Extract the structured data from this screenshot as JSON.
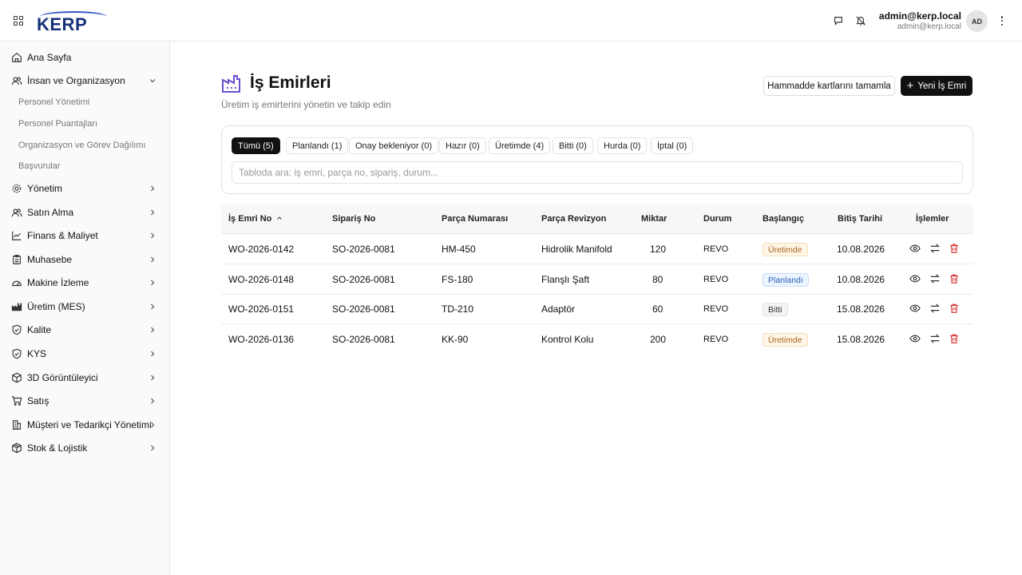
{
  "header": {
    "user_name": "admin@kerp.local",
    "user_email": "admin@kerp.local",
    "avatar_initials": "AD"
  },
  "sidebar": {
    "items": [
      {
        "label": "Ana Sayfa",
        "icon": "home-icon"
      },
      {
        "label": "İnsan ve Organizasyon",
        "icon": "users-icon",
        "expanded": true,
        "children": [
          "Personel Yönetimi",
          "Personel Puantajları",
          "Organizasyon ve Görev Dağılımı",
          "Başvurular"
        ]
      },
      {
        "label": "Yönetim",
        "icon": "gear-icon"
      },
      {
        "label": "Satın Alma",
        "icon": "users-icon"
      },
      {
        "label": "Finans & Maliyet",
        "icon": "chart-line-icon"
      },
      {
        "label": "Muhasebe",
        "icon": "clipboard-icon"
      },
      {
        "label": "Makine İzleme",
        "icon": "gauge-icon"
      },
      {
        "label": "Üretim (MES)",
        "icon": "factory-icon"
      },
      {
        "label": "Kalite",
        "icon": "shield-check-icon"
      },
      {
        "label": "KYS",
        "icon": "shield-check-icon"
      },
      {
        "label": "3D Görüntüleyici",
        "icon": "cube-icon"
      },
      {
        "label": "Satış",
        "icon": "cart-icon"
      },
      {
        "label": "Müşteri ve Tedarikçi Yönetimi",
        "icon": "building-icon"
      },
      {
        "label": "Stok & Lojistik",
        "icon": "package-icon"
      }
    ]
  },
  "page": {
    "title": "İş Emirleri",
    "subtitle": "Üretim iş emirterini yönetin ve takip edin",
    "btn_secondary": "Hammadde kartlarını tamamla",
    "btn_primary": "Yeni İş Emri"
  },
  "filters": {
    "tabs": [
      "Tümü (5)",
      "Planlandı (1)",
      "Onay bekleniyor (0)",
      "Hazır (0)",
      "Üretimde (4)",
      "Bitti (0)",
      "Hurda (0)",
      "İptal (0)"
    ],
    "active_tab": "Tümü (5)",
    "search_placeholder": "Tabloda ara: iş emri, parça no, sipariş, durum..."
  },
  "table": {
    "columns": [
      "İş Emri No",
      "Sipariş No",
      "Parça Numarası",
      "Parça Revizyon",
      "Miktar",
      "Durum",
      "Başlangıç",
      "Bitiş Tarihi",
      "İşlemler"
    ],
    "sorted_column": "İş Emri No",
    "sort_direction": "asc",
    "rows": [
      {
        "wo": "WO-2026-0142",
        "so": "SO-2026-0081",
        "part": "HM-450",
        "rev": "Hidrolik Manifold",
        "qty": "120",
        "status": "REVO",
        "start": "Üretimde",
        "start_type": "uretimde",
        "end": "10.08.2026"
      },
      {
        "wo": "WO-2026-0148",
        "so": "SO-2026-0081",
        "part": "FS-180",
        "rev": "Flanşlı Şaft",
        "qty": "80",
        "status": "REVO",
        "start": "Planlandı",
        "start_type": "planlandi",
        "end": "10.08.2026"
      },
      {
        "wo": "WO-2026-0151",
        "so": "SO-2026-0081",
        "part": "TD-210",
        "rev": "Adaptör",
        "qty": "60",
        "status": "REVO",
        "start": "Bitti",
        "start_type": "bitti",
        "end": "15.08.2026"
      },
      {
        "wo": "WO-2026-0136",
        "so": "SO-2026-0081",
        "part": "KK-90",
        "rev": "Kontrol Kolu",
        "qty": "200",
        "status": "REVO",
        "start": "Üretimde",
        "start_type": "uretimde",
        "end": "15.08.2026"
      }
    ]
  },
  "colors": {
    "primary": "#111111",
    "accent": "#6b4fcf",
    "danger": "#d93636"
  }
}
